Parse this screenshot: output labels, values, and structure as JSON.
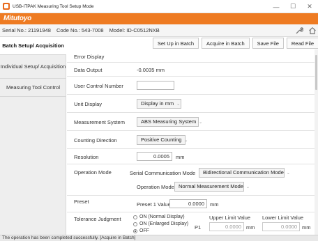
{
  "window": {
    "title": "USB-ITPAK Measuring Tool Setup Mode",
    "minimize": "—",
    "maximize": "☐",
    "close": "✕"
  },
  "brand": "Mitutoyo",
  "info": {
    "serial": "Serial No.: 21191948",
    "code": "Code No.: 543-7008",
    "model": "Model: ID-C0512NXB"
  },
  "sidebar": {
    "items": [
      {
        "label": "Batch Setup/ Acquisition",
        "active": true
      },
      {
        "label": "Individual Setup/ Acquisition",
        "active": false
      },
      {
        "label": "Measuring Tool Control",
        "active": false
      }
    ]
  },
  "toolbar": {
    "setup_batch": "Set Up in Batch",
    "acquire_batch": "Acquire in Batch",
    "save_file": "Save File",
    "read_file": "Read File"
  },
  "settings": {
    "error_display": {
      "label": "Error Display"
    },
    "data_output": {
      "label": "Data Output",
      "value": "-0.0035 mm"
    },
    "user_control": {
      "label": "User Control Number",
      "value": ""
    },
    "unit_display": {
      "label": "Unit Display",
      "value": "Display in mm"
    },
    "measurement_system": {
      "label": "Measurement System",
      "value": "ABS Measuring System"
    },
    "counting_direction": {
      "label": "Counting Direction",
      "value": "Positive Counting"
    },
    "resolution": {
      "label": "Resolution",
      "value": "0.0005",
      "unit": "mm"
    },
    "operation_mode": {
      "label": "Operation Mode",
      "serial_label": "Serial Communication Mode",
      "serial_value": "Bidirectional Communication Mode",
      "op_label": "Operation Mode",
      "op_value": "Normal Measurement Mode"
    },
    "preset": {
      "label": "Preset",
      "sub_label": "Preset 1 Value",
      "value": "0.0000",
      "unit": "mm"
    },
    "tolerance": {
      "label": "Tolerance Judgment",
      "options": [
        "ON (Normal Display)",
        "ON (Enlarged Display)",
        "OFF"
      ],
      "selected": "OFF",
      "p1": "P1",
      "upper_label": "Upper Limit Value",
      "upper_value": "0.0000",
      "upper_unit": "mm",
      "lower_label": "Lower Limit Value",
      "lower_value": "0.0000",
      "lower_unit": "mm"
    }
  },
  "status": "The operation has been completed successfully. [Acquire in Batch]"
}
